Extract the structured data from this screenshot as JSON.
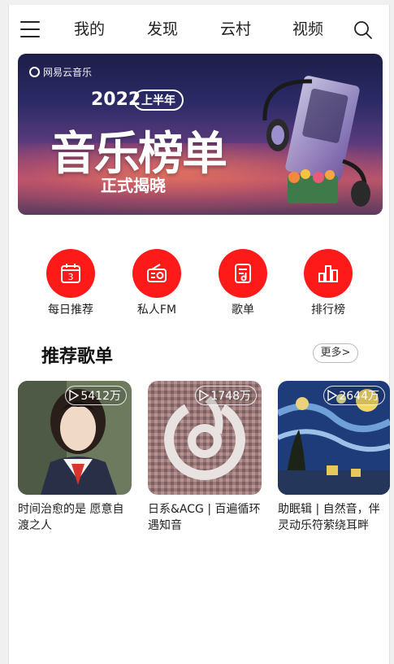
{
  "nav": {
    "tabs": [
      "我的",
      "发现",
      "云村",
      "视频"
    ]
  },
  "banner": {
    "brand": "网易云音乐",
    "year": "2022",
    "half": "上半年",
    "title": "音乐榜单",
    "subtitle": "正式揭晓"
  },
  "quick": [
    {
      "label": "每日推荐",
      "icon": "calendar-icon",
      "day": "3"
    },
    {
      "label": "私人FM",
      "icon": "radio-icon"
    },
    {
      "label": "歌单",
      "icon": "playlist-icon"
    },
    {
      "label": "排行榜",
      "icon": "bar-chart-icon"
    }
  ],
  "section": {
    "title": "推荐歌单",
    "more": "更多>"
  },
  "playlists": [
    {
      "count": "5412万",
      "title": "时间治愈的是 愿意自渡之人"
    },
    {
      "count": "1748万",
      "title": "日系&ACG | 百遍循环遇知音"
    },
    {
      "count": "2644万",
      "title": "助眠辑 | 自然音，伴灵动乐符萦绕耳畔"
    }
  ],
  "colors": {
    "accent": "#ff1a1a",
    "background": "#ffffff"
  }
}
